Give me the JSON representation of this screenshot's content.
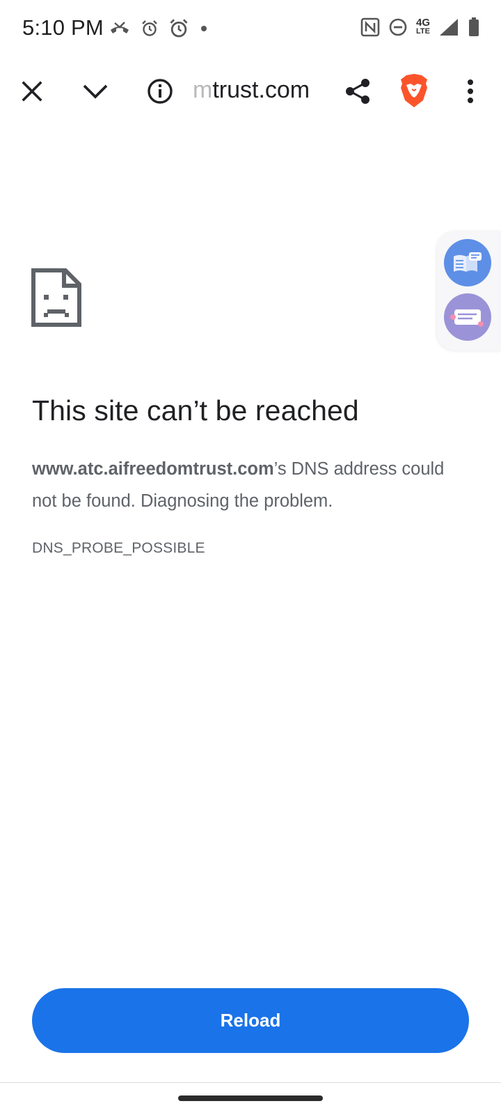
{
  "status_bar": {
    "time": "5:10 PM",
    "network_top": "4G",
    "network_bottom": "LTE",
    "icons_left": [
      "missed-call-icon",
      "alarm-icon",
      "alarm-icon",
      "notification-dot-icon"
    ],
    "icons_right": [
      "nfc-icon",
      "do-not-disturb-icon",
      "network-4g-lte-icon",
      "signal-icon",
      "battery-icon"
    ]
  },
  "toolbar": {
    "url_faded": "m",
    "url_visible": "trust.com",
    "icons": [
      "close-icon",
      "chevron-down-icon",
      "info-icon",
      "share-icon",
      "brave-shield-icon",
      "more-vert-icon"
    ]
  },
  "float_panel": {
    "icons": [
      "reader-mode-icon",
      "summarize-icon"
    ]
  },
  "error": {
    "title": "This site can’t be reached",
    "domain": "www.atc.aifreedomtrust.com",
    "message_part1": "’s DNS address could",
    "message_part2": "not be found. Diagnosing the problem.",
    "code": "DNS_PROBE_POSSIBLE"
  },
  "reload_button": {
    "label": "Reload"
  },
  "colors": {
    "accent": "#1a73e8",
    "brave_orange": "#fb542b",
    "text_primary": "#202124",
    "text_secondary": "#5f6368"
  }
}
